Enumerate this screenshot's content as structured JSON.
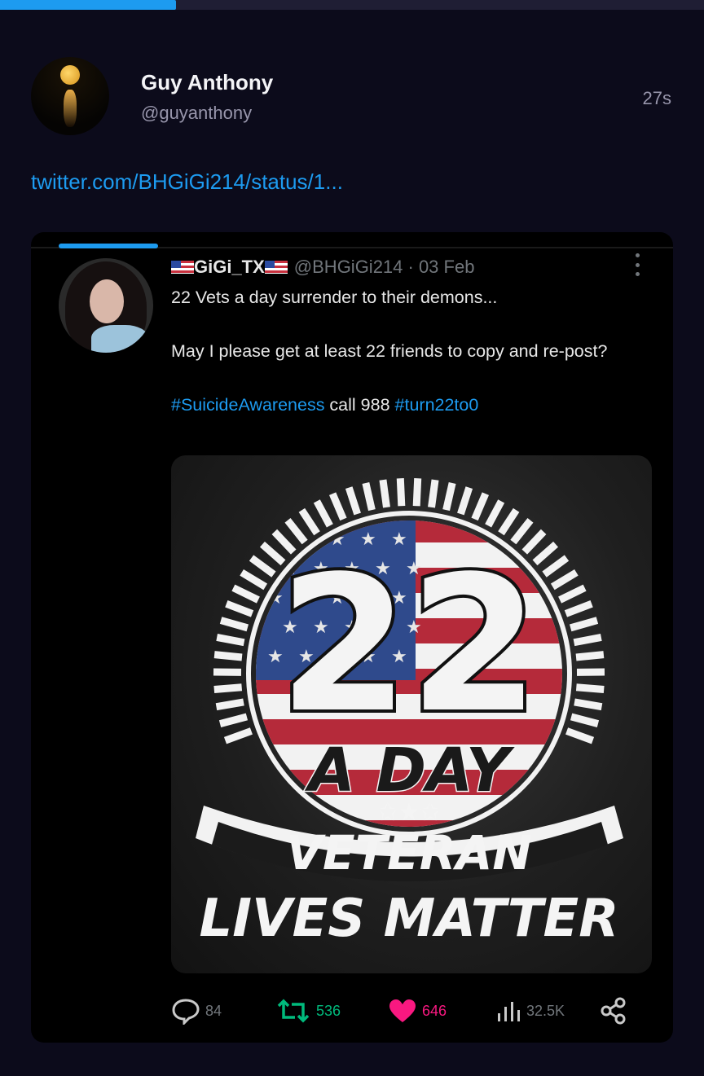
{
  "progress": {
    "fraction": 0.25,
    "color": "#1d9bf0"
  },
  "post": {
    "display_name": "Guy Anthony",
    "handle": "@guyanthony",
    "time": "27s",
    "link": "twitter.com/BHGiGi214/status/1..."
  },
  "embed": {
    "name": "GiGi_TX",
    "meta": "@BHGiGi214 · 03 Feb",
    "line1": "22 Vets a day surrender to their demons...",
    "line2": "May I please get at least 22 friends to copy and re-post?",
    "tag1": "#SuicideAwareness",
    "mid_text": " call 988 ",
    "tag2": "#turn22to0",
    "image_text": {
      "number": "22",
      "a_day": "A DAY",
      "veteran": "VETERAN",
      "lives_matter": "LIVES MATTER"
    },
    "stats": {
      "replies": "84",
      "retweets": "536",
      "likes": "646",
      "views": "32.5K"
    }
  },
  "colors": {
    "background": "#0c0b1b",
    "link": "#1d9bf0",
    "retweet": "#00ba7c",
    "like": "#f91880"
  }
}
